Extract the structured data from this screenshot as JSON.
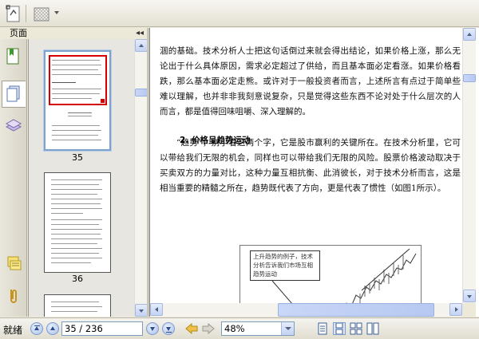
{
  "panel": {
    "title": "页面",
    "collapse_glyph": "◂◂"
  },
  "thumbnails": [
    {
      "page": "35",
      "selected": true
    },
    {
      "page": "36",
      "selected": false
    }
  ],
  "document": {
    "para1": "涸的基础。技术分析人士把这句话倒过来就会得出结论，如果价格上涨，那么无论出于什么具体原因，需求必定超过了供给，而且基本面必定看涨。如果价格看跌，那么基本面必定走熊。或许对于一般投资者而言，上述所言有点过于简单些难以理解，也并非非我刻意说复杂，只是觉得这些东西不论对处于什么层次的人而言，都是值得回味咀嚼、深入理解的。",
    "heading": "2.  价格呈趋势运动",
    "para2": "“趋势”，别小看这两个字，它是股市赢利的关键所在。在技术分析里，它可以带给我们无限的机会，同样也可以带给我们无限的风险。股票价格波动取决于买卖双方的力量对比，这种力量互相抗衡、此消彼长，对于技术分析而言，这是相当重要的精髓之所在，趋势既代表了方向，更是代表了惯性（如图1所示）。",
    "figure_note": "上升趋势的例子，技术分析告诉我们市场互相趋势运动"
  },
  "statusbar": {
    "status": "就绪",
    "page_indicator": "35 / 236",
    "zoom": "48%"
  },
  "colors": {
    "selection": "#7da2ce",
    "highlight_box": "#d40000",
    "scrollbar": "#c4d3f3"
  },
  "icons": {
    "toolbar": [
      "snapshot-icon",
      "select-tool-icon"
    ],
    "nav": [
      "bookmarks-icon",
      "pages-icon",
      "layers-icon",
      "comments-icon",
      "attachments-icon"
    ],
    "status": [
      "first-page-icon",
      "prev-page-icon",
      "next-page-icon",
      "last-page-icon",
      "back-icon",
      "forward-icon",
      "single-page-icon",
      "continuous-icon",
      "facing-icon",
      "continuous-facing-icon"
    ]
  }
}
